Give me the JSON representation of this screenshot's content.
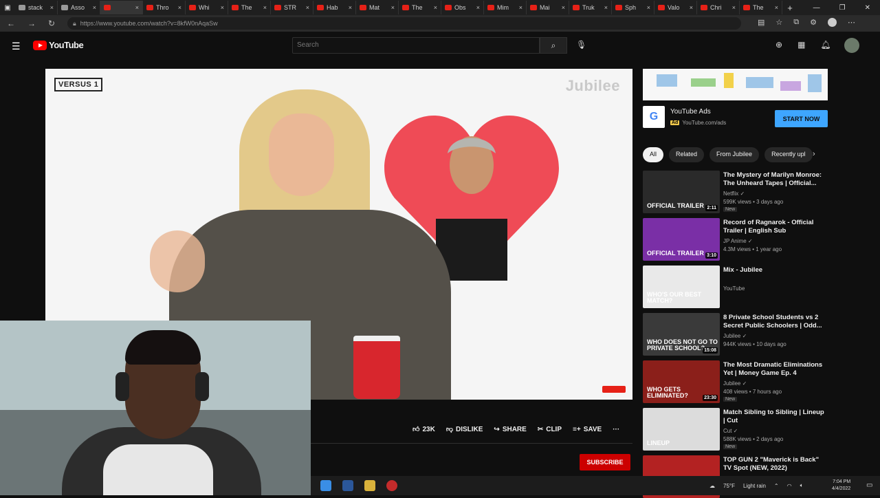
{
  "browser": {
    "tabs": [
      {
        "label": "stack"
      },
      {
        "label": "Asso"
      },
      {
        "label": ""
      },
      {
        "label": "Thro"
      },
      {
        "label": "Whi"
      },
      {
        "label": "The"
      },
      {
        "label": "STR"
      },
      {
        "label": "Hab"
      },
      {
        "label": "Mat"
      },
      {
        "label": "The"
      },
      {
        "label": "Obs"
      },
      {
        "label": "Mim"
      },
      {
        "label": "Mai"
      },
      {
        "label": "Truk"
      },
      {
        "label": "Sph"
      },
      {
        "label": "Valo"
      },
      {
        "label": "Chri"
      },
      {
        "label": "The"
      }
    ],
    "close_glyph": "×",
    "url": "https://www.youtube.com/watch?v=8kfW0nAqaSw"
  },
  "youtube": {
    "logo_text": "YouTube",
    "search_placeholder": "Search"
  },
  "video": {
    "versus_label": "VERSUS 1",
    "channel_watermark": "Jubilee",
    "actions": {
      "like_count": "23K",
      "dislike": "DISLIKE",
      "share": "SHARE",
      "clip": "CLIP",
      "save": "SAVE",
      "more": "···"
    },
    "subscribe_label": "SUBSCRIBE"
  },
  "ad": {
    "title": "YouTube Ads",
    "badge": "Ad",
    "domain": "YouTube.com/ads",
    "cta": "START NOW"
  },
  "chips": [
    "All",
    "Related",
    "From Jubilee",
    "Recently upl"
  ],
  "recommendations": [
    {
      "title": "The Mystery of Marilyn Monroe: The Unheard Tapes | Official...",
      "channel": "Netflix ✓",
      "meta": "599K views • 3 days ago",
      "badge": "New",
      "duration": "2:11",
      "thumb_text": "OFFICIAL TRAILER",
      "thumb_color": "#2a2a2a"
    },
    {
      "title": "Record of Ragnarok - Official Trailer | English Sub",
      "channel": "JP Anime ✓",
      "meta": "4.3M views • 1 year ago",
      "badge": "",
      "duration": "3:10",
      "thumb_text": "OFFICIAL TRAILER",
      "thumb_color": "#7a2fa6"
    },
    {
      "title": "Mix - Jubilee",
      "channel": "YouTube",
      "meta": "",
      "badge": "",
      "duration": "",
      "thumb_text": "WHO'S OUR BEST MATCH?",
      "thumb_color": "#e9e9e9"
    },
    {
      "title": "8 Private School Students vs 2 Secret Public Schoolers | Odd...",
      "channel": "Jubilee ✓",
      "meta": "944K views • 10 days ago",
      "badge": "",
      "duration": "15:08",
      "thumb_text": "WHO DOES NOT GO TO PRIVATE SCHOOL?",
      "thumb_color": "#3a3a3a"
    },
    {
      "title": "The Most Dramatic Eliminations Yet | Money Game Ep. 4",
      "channel": "Jubilee ✓",
      "meta": "408 views • 7 hours ago",
      "badge": "New",
      "duration": "23:30",
      "thumb_text": "WHO GETS ELIMINATED?",
      "thumb_color": "#8b1f1a"
    },
    {
      "title": "Match Sibling to Sibling | Lineup | Cut",
      "channel": "Cut ✓",
      "meta": "588K views • 2 days ago",
      "badge": "New",
      "duration": "",
      "thumb_text": "LINEUP",
      "thumb_color": "#dcdcdc"
    },
    {
      "title": "TOP GUN 2 \"Maverick is Back\" TV Spot (NEW, 2022)",
      "channel": "",
      "meta": "",
      "badge": "",
      "duration": "",
      "thumb_text": "",
      "thumb_color": "#b32222"
    }
  ],
  "taskbar": {
    "weather": "75°F",
    "weather_desc": "Light rain",
    "time": "7:04 PM",
    "date": "4/4/2022"
  }
}
